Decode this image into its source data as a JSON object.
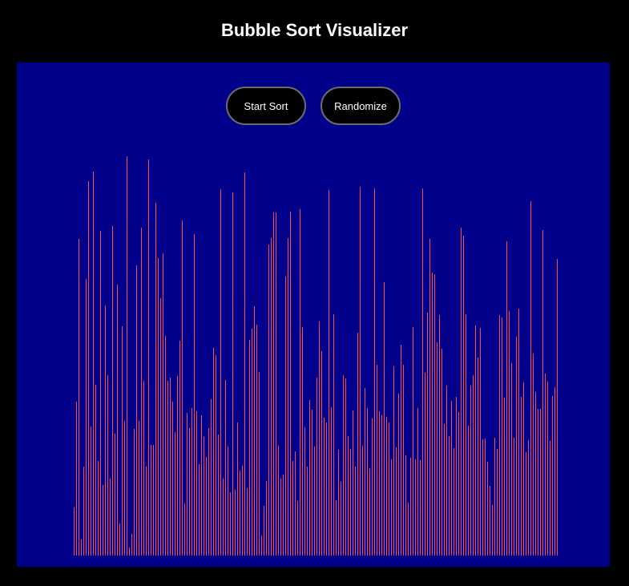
{
  "title": "Bubble Sort Visualizer",
  "controls": {
    "start_label": "Start Sort",
    "randomize_label": "Randomize"
  },
  "colors": {
    "page_background": "#000000",
    "stage_background": "#00008b",
    "bar": "#ff4a4a",
    "button_background": "#000000",
    "button_border": "#6b6b6b"
  },
  "array_values": [
    60,
    192,
    395,
    20,
    111,
    345,
    467,
    161,
    479,
    213,
    118,
    405,
    88,
    312,
    225,
    96,
    411,
    152,
    338,
    40,
    286,
    168,
    498,
    10,
    27,
    158,
    362,
    168,
    409,
    218,
    111,
    494,
    138,
    138,
    440,
    371,
    321,
    377,
    274,
    218,
    222,
    192,
    154,
    224,
    268,
    418,
    65,
    178,
    159,
    184,
    401,
    180,
    114,
    175,
    148,
    123,
    159,
    195,
    259,
    250,
    151,
    457,
    96,
    219,
    136,
    79,
    453,
    82,
    166,
    106,
    112,
    478,
    84,
    269,
    283,
    311,
    288,
    229,
    25,
    62,
    93,
    388,
    396,
    428,
    428,
    137,
    96,
    101,
    348,
    396,
    429,
    118,
    130,
    68,
    432,
    285,
    160,
    111,
    194,
    182,
    136,
    222,
    292,
    255,
    172,
    166,
    456,
    185,
    301,
    69,
    132,
    92,
    225,
    221,
    149,
    133,
    181,
    111,
    278,
    460,
    137,
    209,
    184,
    109,
    171,
    458,
    238,
    180,
    175,
    341,
    173,
    166,
    120,
    236,
    135,
    202,
    263,
    238,
    125,
    66,
    122,
    285,
    120,
    184,
    119,
    458,
    228,
    303,
    395,
    353,
    351,
    266,
    300,
    258,
    164,
    212,
    149,
    193,
    134,
    198,
    179,
    409,
    399,
    301,
    162,
    212,
    225,
    287,
    247,
    284,
    145,
    146,
    117,
    87,
    63,
    147,
    133,
    300,
    297,
    197,
    392,
    305,
    240,
    147,
    273,
    308,
    198,
    216,
    129,
    144,
    442,
    252,
    204,
    183,
    183,
    406,
    227,
    217,
    143,
    199,
    210,
    370
  ],
  "max_value": 500
}
